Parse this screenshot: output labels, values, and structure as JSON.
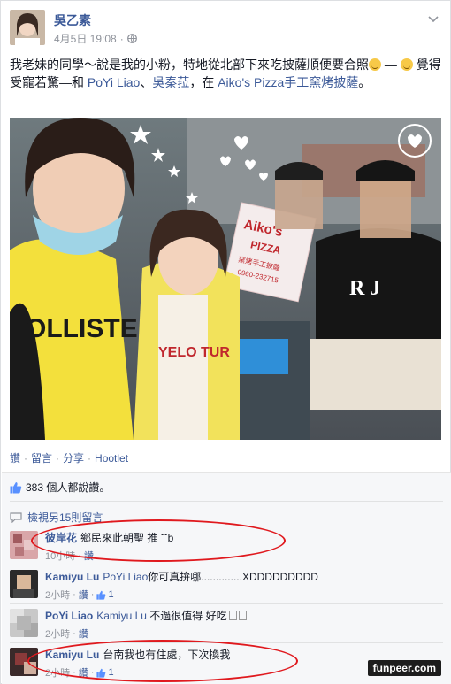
{
  "post": {
    "author": "吳乙素",
    "date": "4月5日 19:08",
    "dot": "·",
    "text_part1": "我老妹的同學～說是我的小粉，特地從北部下來吃披薩順便要合照",
    "text_part2": " — ",
    "text_part3": "覺得受寵若驚—和 ",
    "tag1": "PoYi Liao",
    "text_sep": "、",
    "tag2": "吳秦菈",
    "text_at": "，在 ",
    "place": "Aiko's Pizza手工窯烤披薩",
    "text_end": "。"
  },
  "photo": {
    "sign_line1": "Aiko's",
    "sign_line2": "PIZZA",
    "sign_line3": "窯烤手工披薩",
    "sign_phone": "0960-232715",
    "shirt_left": "OLLISTE",
    "shirt_mid": "YELO TUR",
    "shirt_right": "R J"
  },
  "actions": {
    "like": "讚",
    "comment": "留言",
    "share": "分享",
    "hootlet": "Hootlet",
    "sep": "·"
  },
  "likes": {
    "text": "383 個人都說讚。"
  },
  "view_more": {
    "text": "檢視另15則留言"
  },
  "comments": [
    {
      "name": "彼岸花",
      "mention": "",
      "text": "鄉民來此朝聖 推 ˇˇb",
      "time": "10小時",
      "like": "讚",
      "likes_count": ""
    },
    {
      "name": "Kamiyu Lu",
      "mention": "PoYi Liao",
      "text": "你可真拚哪..............XDDDDDDDDD",
      "time": "2小時",
      "like": "讚",
      "likes_count": "1"
    },
    {
      "name": "PoYi Liao",
      "mention": "Kamiyu Lu",
      "text": " 不過很值得 好吃",
      "time": "2小時",
      "like": "讚",
      "likes_count": ""
    },
    {
      "name": "Kamiyu Lu",
      "mention": "",
      "text": "台南我也有住處，下次換我",
      "time": "2小時",
      "like": "讚",
      "likes_count": "1"
    }
  ],
  "watermark": "funpeer.com",
  "colors": {
    "link": "#3b5998",
    "meta": "#90949c",
    "annotation": "#e0191e"
  }
}
